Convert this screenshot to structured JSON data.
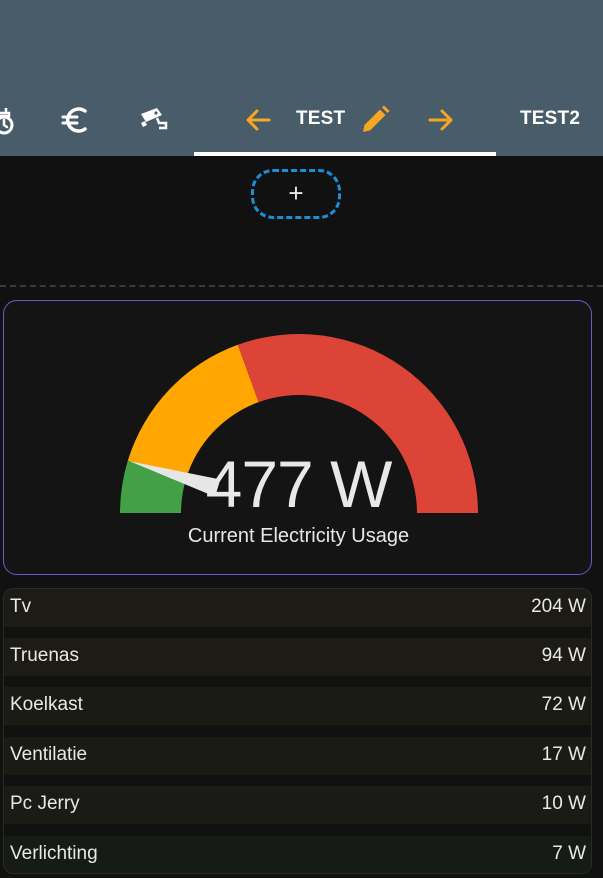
{
  "header": {
    "tabs": [
      {
        "icon": "clock-plug-icon"
      },
      {
        "icon": "euro-icon"
      },
      {
        "icon": "cctv-camera-icon"
      },
      {
        "label": "TEST",
        "active": true
      },
      {
        "label": "TEST2"
      }
    ],
    "active_tab_controls": {
      "move_left_icon": "arrow-left-icon",
      "edit_icon": "pencil-icon",
      "move_right_icon": "arrow-right-icon"
    },
    "colors": {
      "background": "#495c69",
      "accent": "#f5a623",
      "indicator": "#ffffff"
    }
  },
  "add_card": {
    "label": "+"
  },
  "gauge": {
    "value": 477,
    "value_text": "477 W",
    "name": "Current Electricity Usage",
    "severity_colors": {
      "green": "#43a047",
      "yellow": "#ffa600",
      "red": "#db4437"
    }
  },
  "power_list": {
    "rows": [
      {
        "name": "Tv",
        "value": "204 W"
      },
      {
        "name": "Truenas",
        "value": "94 W"
      },
      {
        "name": "Koelkast",
        "value": "72 W"
      },
      {
        "name": "Ventilatie",
        "value": "17 W"
      },
      {
        "name": "Pc Jerry",
        "value": "10 W"
      },
      {
        "name": "Verlichting",
        "value": "7 W"
      }
    ]
  }
}
